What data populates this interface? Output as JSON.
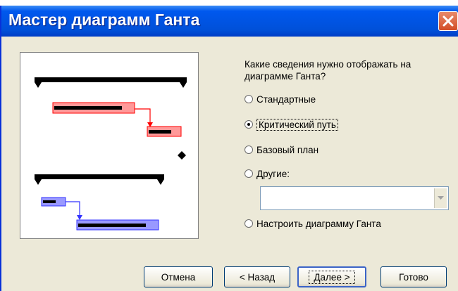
{
  "window": {
    "title": "Мастер диаграмм Ганта"
  },
  "question": "Какие сведения нужно отображать на диаграмме Ганта?",
  "options": [
    {
      "label": "Стандартные",
      "checked": false
    },
    {
      "label": "Критический путь",
      "checked": true
    },
    {
      "label": "Базовый план",
      "checked": false
    },
    {
      "label": "Другие:",
      "checked": false
    },
    {
      "label": "Настроить диаграмму Ганта",
      "checked": false
    }
  ],
  "other_combo": {
    "value": ""
  },
  "buttons": {
    "cancel": "Отмена",
    "back": "< Назад",
    "next": "Далее >",
    "finish": "Готово"
  },
  "colors": {
    "title_bar": "#0054e3",
    "critical_task": "#ff0000",
    "normal_task": "#3333ff",
    "summary": "#000000"
  }
}
